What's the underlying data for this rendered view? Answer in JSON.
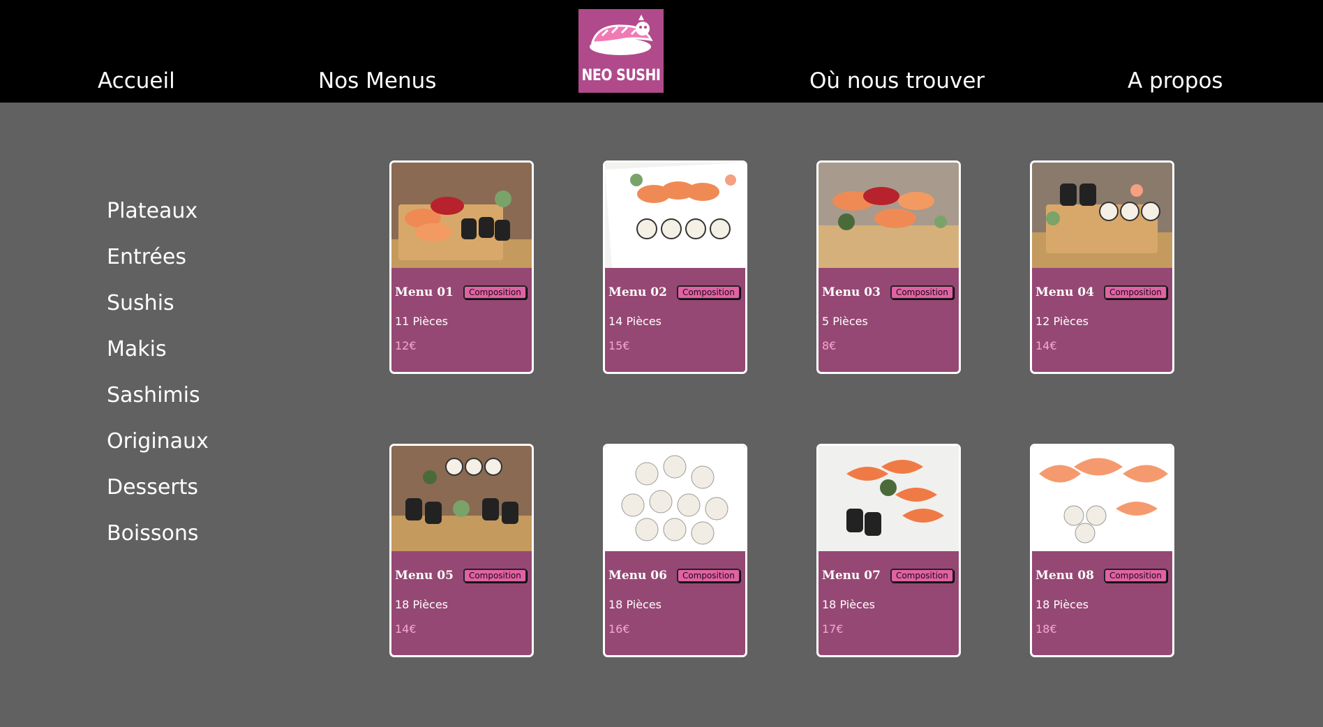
{
  "header": {
    "nav": [
      "Accueil",
      "Nos Menus",
      "Où nous trouver",
      "A propos"
    ],
    "logo_text": "NEO SUSHI"
  },
  "sidebar": {
    "items": [
      "Plateaux",
      "Entrées",
      "Sushis",
      "Makis",
      "Sashimis",
      "Originaux",
      "Desserts",
      "Boissons"
    ]
  },
  "menus": [
    {
      "title": "Menu 01",
      "button": "Composition",
      "pieces": "11 Pièces",
      "price": "12€"
    },
    {
      "title": "Menu 02",
      "button": "Composition",
      "pieces": "14 Pièces",
      "price": "15€"
    },
    {
      "title": "Menu 03",
      "button": "Composition",
      "pieces": "5 Pièces",
      "price": "8€"
    },
    {
      "title": "Menu 04",
      "button": "Composition",
      "pieces": "12 Pièces",
      "price": "14€"
    },
    {
      "title": "Menu 05",
      "button": "Composition",
      "pieces": "18 Pièces",
      "price": "14€"
    },
    {
      "title": "Menu 06",
      "button": "Composition",
      "pieces": "18 Pièces",
      "price": "16€"
    },
    {
      "title": "Menu 07",
      "button": "Composition",
      "pieces": "18 Pièces",
      "price": "17€"
    },
    {
      "title": "Menu 08",
      "button": "Composition",
      "pieces": "18 Pièces",
      "price": "18€"
    }
  ],
  "colors": {
    "header_bg": "#000000",
    "page_bg": "#616161",
    "card_bg": "#954873",
    "logo_bg": "#b04a8b",
    "price_text": "#f5a8cf",
    "button_bg": "#e062a4"
  }
}
